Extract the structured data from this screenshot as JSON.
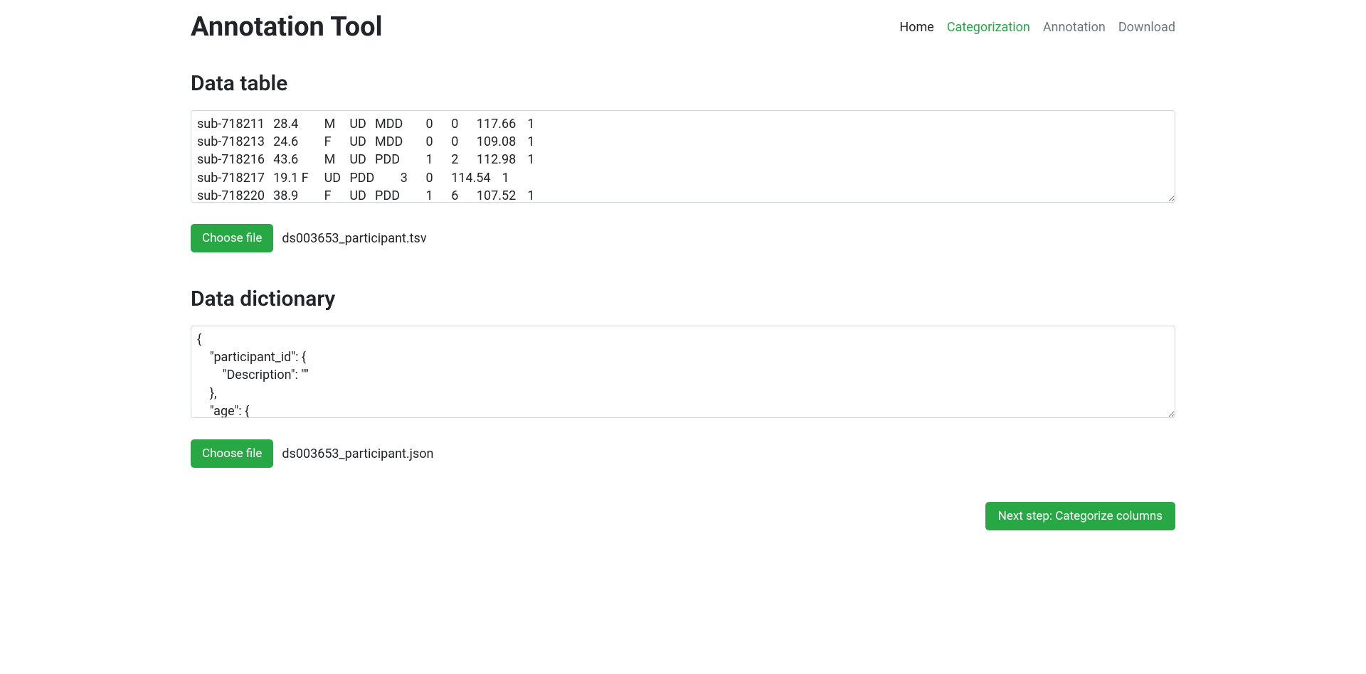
{
  "header": {
    "title": "Annotation Tool"
  },
  "nav": {
    "home": "Home",
    "categorization": "Categorization",
    "annotation": "Annotation",
    "download": "Download"
  },
  "data_table": {
    "title": "Data table",
    "content": "sub-718211\t28.4\tM\tUD\tMDD\t0\t0\t117.66\t1\nsub-718213\t24.6\tF\tUD\tMDD\t0\t0\t109.08\t1\nsub-718216\t43.6\tM\tUD\tPDD\t1\t2\t112.98\t1\nsub-718217\t19.1 F\tUD\tPDD\t3\t0\t114.54\t1\nsub-718220\t38.9\tF\tUD\tPDD\t1\t6\t107.52\t1",
    "choose_file_label": "Choose file",
    "file_name": "ds003653_participant.tsv"
  },
  "data_dictionary": {
    "title": "Data dictionary",
    "content": "{\n    \"participant_id\": {\n        \"Description\": \"\"\n    },\n    \"age\": {",
    "choose_file_label": "Choose file",
    "file_name": "ds003653_participant.json"
  },
  "footer": {
    "next_button": "Next step: Categorize columns"
  }
}
